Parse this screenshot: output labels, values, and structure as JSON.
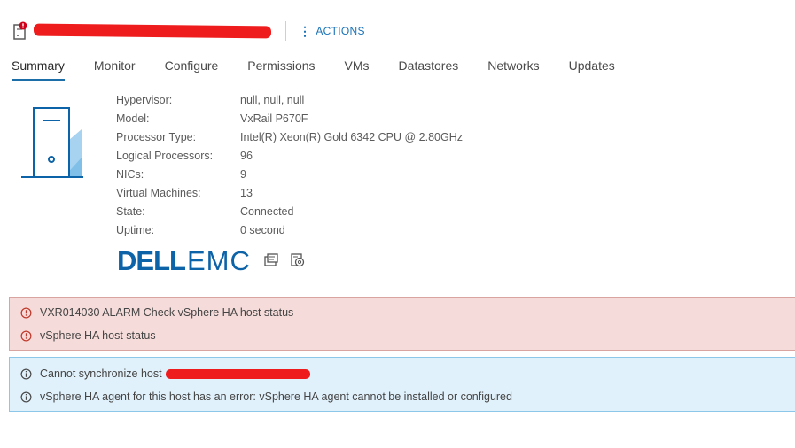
{
  "header": {
    "actions_label": "ACTIONS"
  },
  "tabs": [
    {
      "label": "Summary",
      "active": true
    },
    {
      "label": "Monitor"
    },
    {
      "label": "Configure"
    },
    {
      "label": "Permissions"
    },
    {
      "label": "VMs"
    },
    {
      "label": "Datastores"
    },
    {
      "label": "Networks"
    },
    {
      "label": "Updates"
    }
  ],
  "host_properties": [
    {
      "key": "Hypervisor:",
      "value": "null, null, null"
    },
    {
      "key": "Model:",
      "value": "VxRail P670F"
    },
    {
      "key": "Processor Type:",
      "value": "Intel(R) Xeon(R) Gold 6342 CPU @ 2.80GHz"
    },
    {
      "key": "Logical Processors:",
      "value": "96"
    },
    {
      "key": "NICs:",
      "value": "9"
    },
    {
      "key": "Virtual Machines:",
      "value": "13"
    },
    {
      "key": "State:",
      "value": "Connected"
    },
    {
      "key": "Uptime:",
      "value": "0 second"
    }
  ],
  "brand": {
    "dell": "DELL",
    "emc": "EMC"
  },
  "alarms": [
    {
      "text": "VXR014030 ALARM Check vSphere HA host status"
    },
    {
      "text": "vSphere HA host status"
    }
  ],
  "info_messages": [
    {
      "text": "Cannot synchronize host"
    },
    {
      "text": "vSphere HA agent for this host has an error: vSphere HA agent cannot be installed or configured"
    }
  ],
  "colors": {
    "accent": "#1b6ea8",
    "brand_blue": "#0c63a8",
    "alarm_bg": "#f5dcda",
    "alarm_icon": "#c0392b",
    "info_bg": "#e1f1fb",
    "info_icon": "#4a4a4a",
    "redaction": "#ee1c1c"
  },
  "icons": {
    "host": "host-warning-icon",
    "actions": "vertical-dots-icon",
    "alarm": "exclamation-circle-icon",
    "info": "info-circle-icon",
    "brand_1": "host-console-icon",
    "brand_2": "host-settings-icon"
  }
}
